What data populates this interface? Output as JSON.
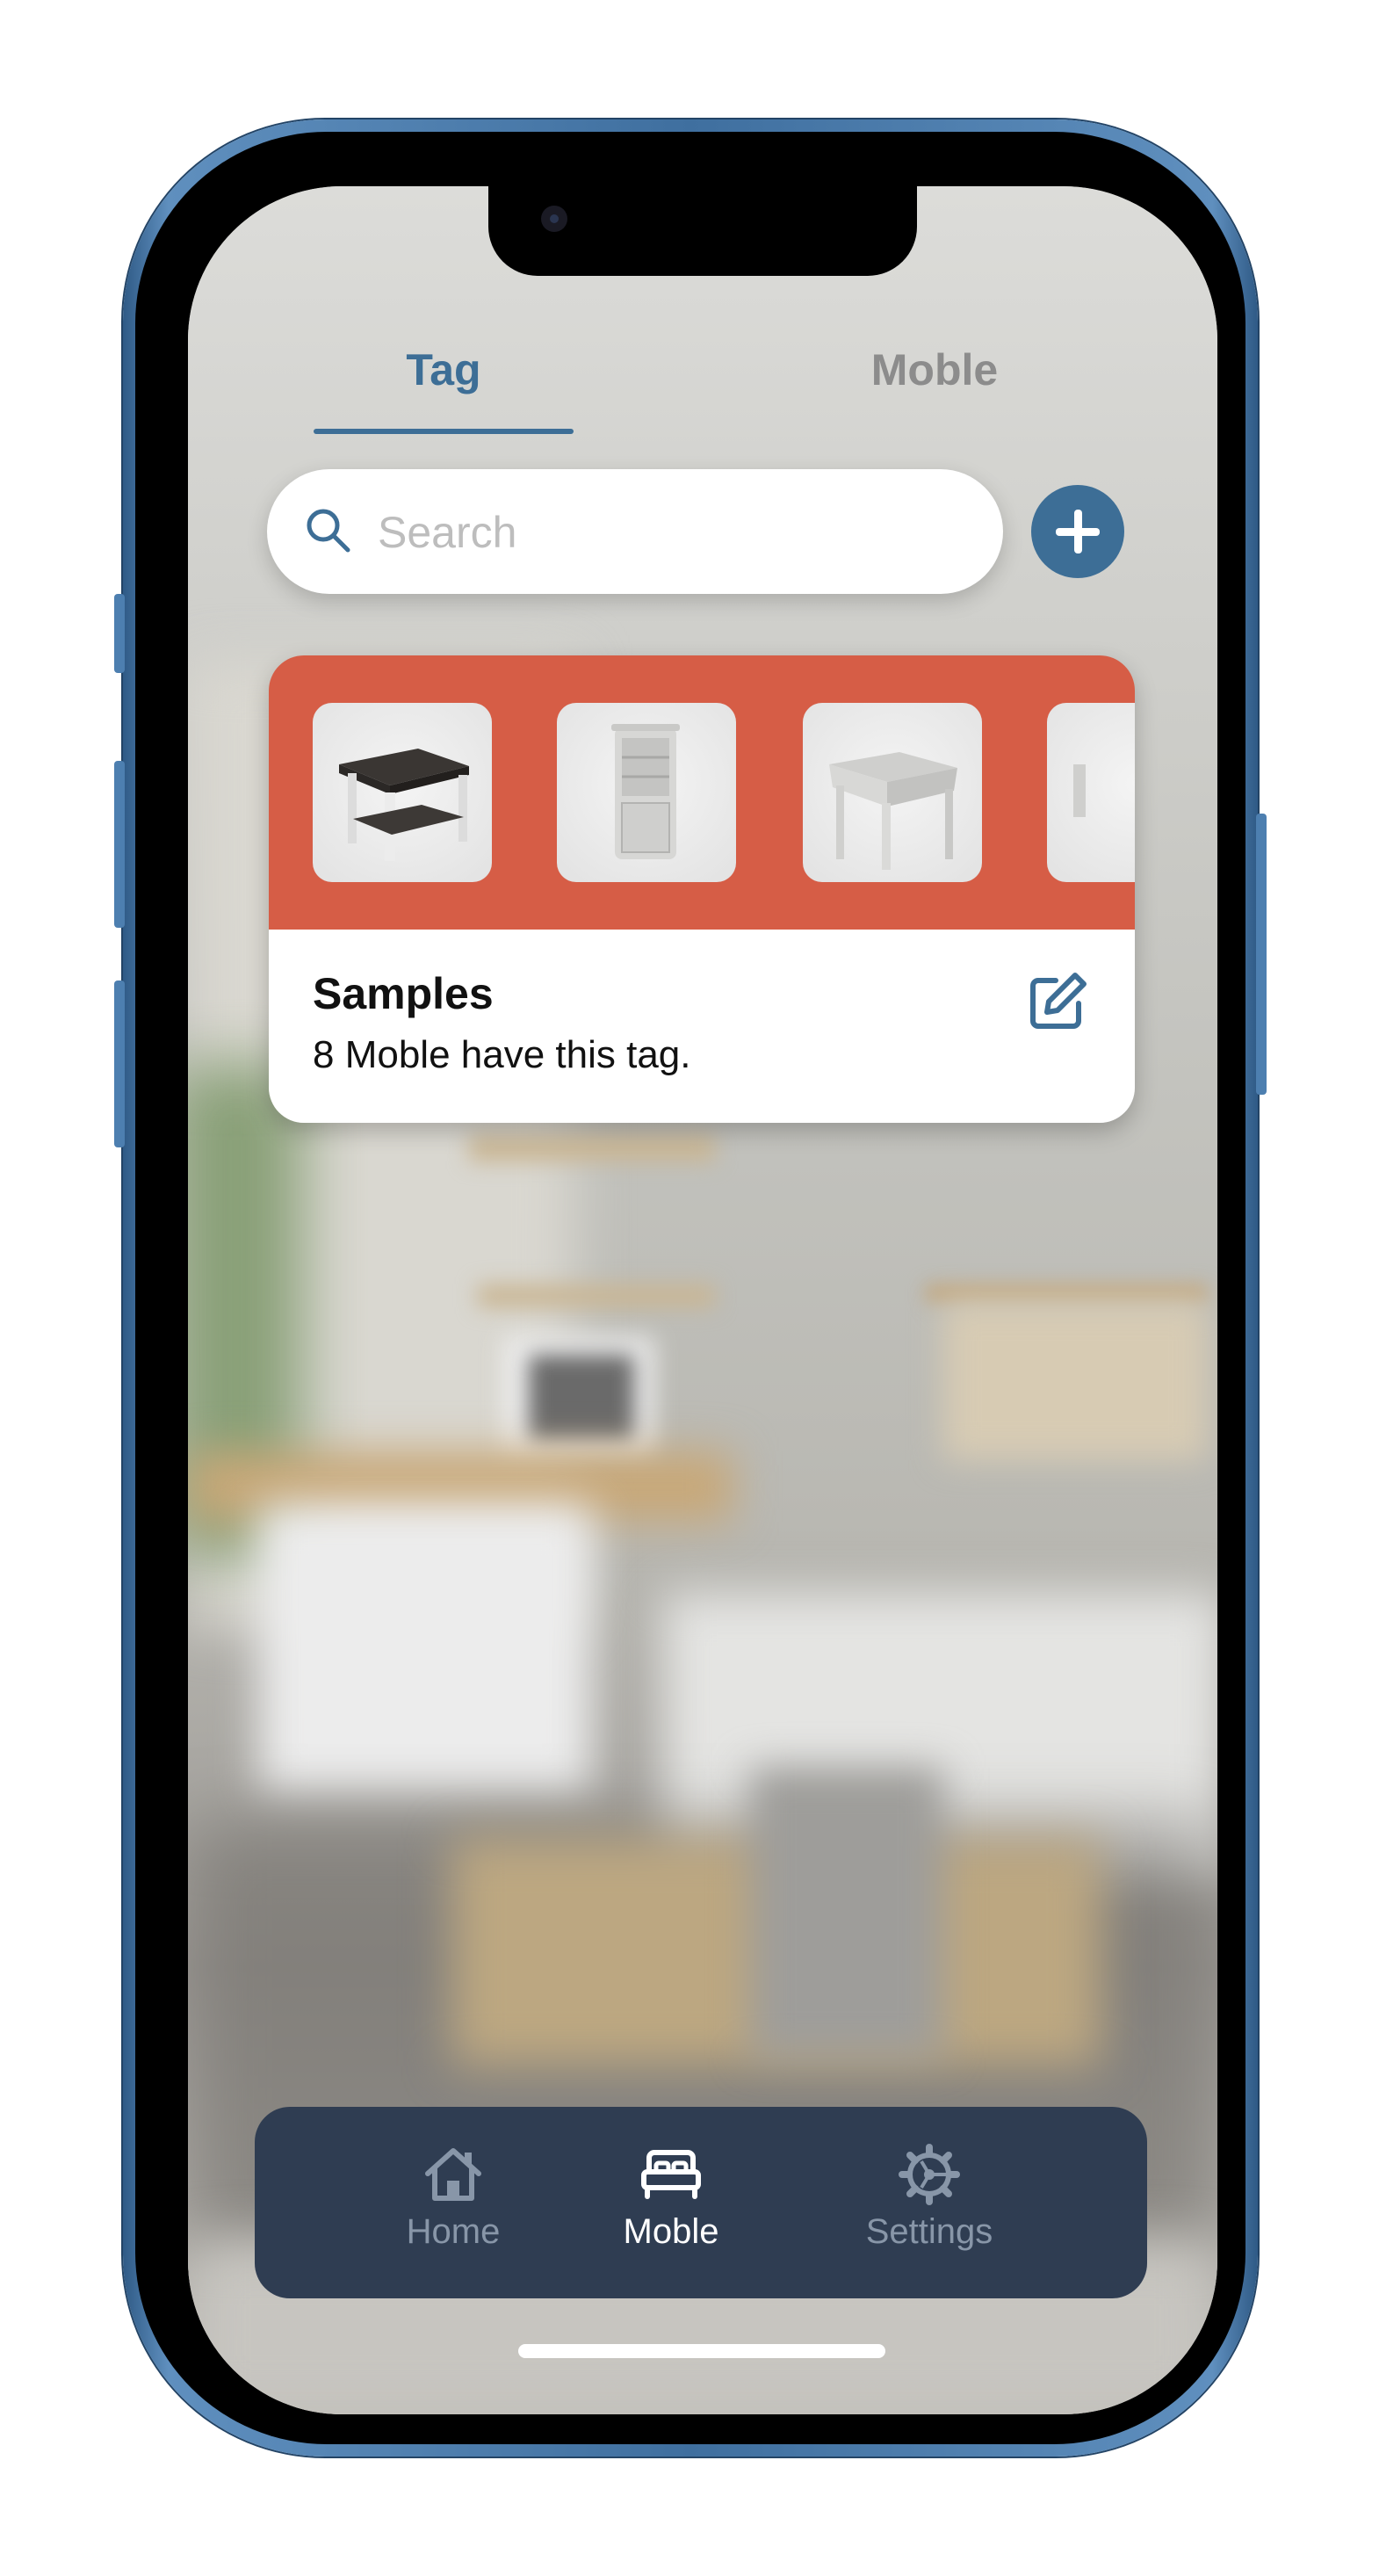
{
  "top_tabs": [
    {
      "label": "Tag",
      "active": true
    },
    {
      "label": "Moble",
      "active": false
    }
  ],
  "search": {
    "placeholder": "Search",
    "value": ""
  },
  "add_button": {
    "icon": "plus-icon"
  },
  "tag_card": {
    "header_color": "#d65d46",
    "thumbnails": [
      "coffee-table",
      "corner-cabinet",
      "side-table",
      "partial-item"
    ],
    "title": "Samples",
    "subtitle": "8 Moble have this tag.",
    "edit_icon": "edit-icon"
  },
  "bottom_nav": {
    "items": [
      {
        "label": "Home",
        "icon": "home-icon",
        "active": false
      },
      {
        "label": "Moble",
        "icon": "bed-icon",
        "active": true
      },
      {
        "label": "Settings",
        "icon": "gear-icon",
        "active": false
      }
    ]
  },
  "colors": {
    "accent": "#3d6e96",
    "nav_background": "#2f3d52",
    "card_header": "#d65d46",
    "inactive_text": "#8c8c8c"
  }
}
